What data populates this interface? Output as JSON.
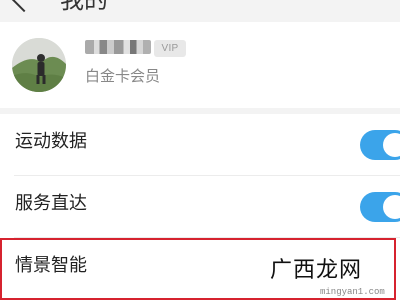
{
  "header": {
    "title": "我的"
  },
  "profile": {
    "username": "",
    "vip_badge": "VIP",
    "member_level": "白金卡会员"
  },
  "settings": {
    "items": [
      {
        "label": "运动数据",
        "toggle_on": true
      },
      {
        "label": "服务直达",
        "toggle_on": true
      },
      {
        "label": "情景智能"
      }
    ]
  },
  "watermark": {
    "text": "广西龙网",
    "url": "mingyan1.com"
  },
  "colors": {
    "toggle_on": "#3ba4ea",
    "highlight": "#d6232f",
    "page_background": "#f3f3f3"
  }
}
